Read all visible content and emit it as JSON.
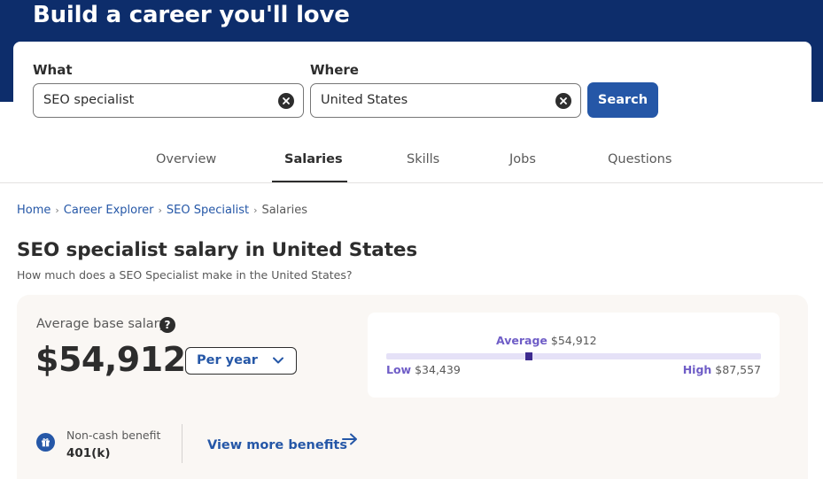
{
  "hero": {
    "title": "Build a career you'll love"
  },
  "search": {
    "what_label": "What",
    "what_value": "SEO specialist",
    "where_label": "Where",
    "where_value": "United States",
    "button_label": "Search"
  },
  "tabs": [
    {
      "label": "Overview",
      "active": false
    },
    {
      "label": "Salaries",
      "active": true
    },
    {
      "label": "Skills",
      "active": false
    },
    {
      "label": "Jobs",
      "active": false
    },
    {
      "label": "Questions",
      "active": false
    }
  ],
  "breadcrumb": [
    "Home",
    "Career Explorer",
    "SEO Specialist",
    "Salaries"
  ],
  "page": {
    "title": "SEO specialist salary in United States",
    "subtitle": "How much does a SEO Specialist make in the United States?"
  },
  "salary": {
    "avg_label": "Average base salary",
    "help_glyph": "?",
    "avg_value": "$54,912",
    "period": "Per year",
    "range": {
      "avg_label": "Average",
      "avg_amount": "$54,912",
      "low_label": "Low",
      "low_amount": "$34,439",
      "high_label": "High",
      "high_amount": "$87,557",
      "avg_position_fraction": 0.38
    }
  },
  "benefit": {
    "label": "Non-cash benefit",
    "value": "401(k)",
    "more_link": "View more benefits"
  },
  "colors": {
    "hero_bg": "#0d2d6b",
    "primary_blue": "#2557a7",
    "range_purple": "#6f5dc7",
    "range_dot": "#3d2a8f",
    "panel_bg": "#faf7f4"
  },
  "icons": {
    "clear": "clear-x-circle-icon",
    "help": "question-circle-icon",
    "chevron": "chevron-down-icon",
    "benefit": "gift-icon",
    "arrow": "arrow-right-icon"
  }
}
